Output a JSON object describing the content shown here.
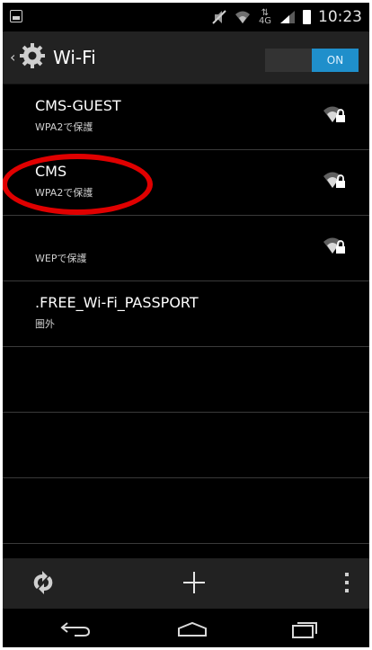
{
  "status_bar": {
    "time": "10:23",
    "data_icon_text": "4G",
    "icons": [
      "screenshot-icon",
      "mute-icon",
      "wifi-status-icon",
      "data-status-icon",
      "signal-icon",
      "battery-icon"
    ]
  },
  "action_bar": {
    "title": "Wi-Fi",
    "toggle_label": "ON",
    "icons": [
      "back-chevron-icon",
      "settings-icon"
    ]
  },
  "networks": [
    {
      "ssid": "CMS-GUEST",
      "status": "WPA2で保護",
      "icon": "wifi-lock-icon"
    },
    {
      "ssid": "CMS",
      "status": "WPA2で保護",
      "icon": "wifi-lock-icon"
    },
    {
      "ssid": "",
      "status": "WEPで保護",
      "icon": "wifi-lock-icon"
    },
    {
      "ssid": ".FREE_Wi-Fi_PASSPORT",
      "status": "圏外",
      "icon": ""
    }
  ],
  "bottom_bar": {
    "icons": [
      "refresh-icon",
      "add-icon",
      "overflow-menu-icon"
    ]
  },
  "nav_bar": {
    "icons": [
      "nav-back-icon",
      "nav-home-icon",
      "nav-recents-icon"
    ]
  },
  "colors": {
    "accent": "#1f8fcb",
    "highlight": "#e00000"
  }
}
